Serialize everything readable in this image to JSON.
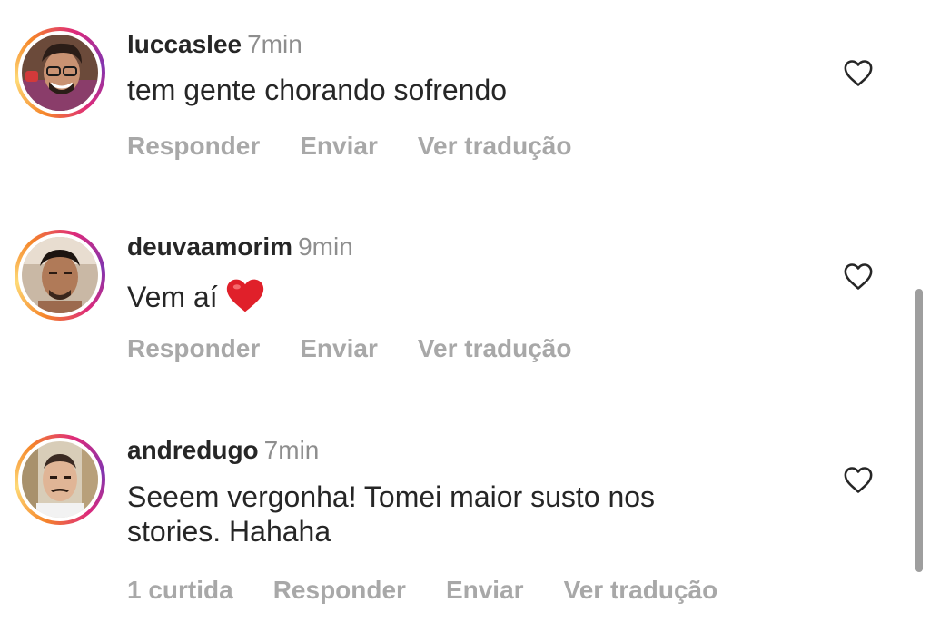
{
  "colors": {
    "username": "#262626",
    "text": "#262626",
    "meta": "#8e8e8e",
    "actions": "#a8a8a8",
    "heart_emoji": "#e0202a",
    "scrollbar": "#9e9e9e"
  },
  "comments": [
    {
      "username": "luccaslee",
      "time": "7min",
      "text": "tem gente chorando sofrendo",
      "actions": [
        "Responder",
        "Enviar",
        "Ver tradução"
      ],
      "like_icon": "heart-outline-icon"
    },
    {
      "username": "deuvaamorim",
      "time": "9min",
      "text": "Vem aí",
      "emoji": "red-heart-emoji",
      "actions": [
        "Responder",
        "Enviar",
        "Ver tradução"
      ],
      "like_icon": "heart-outline-icon"
    },
    {
      "username": "andredugo",
      "time": "7min",
      "text_lines": [
        "Seeem vergonha! Tomei maior susto nos",
        "stories. Hahaha"
      ],
      "actions": [
        "1 curtida",
        "Responder",
        "Enviar",
        "Ver tradução"
      ],
      "like_icon": "heart-outline-icon"
    }
  ]
}
